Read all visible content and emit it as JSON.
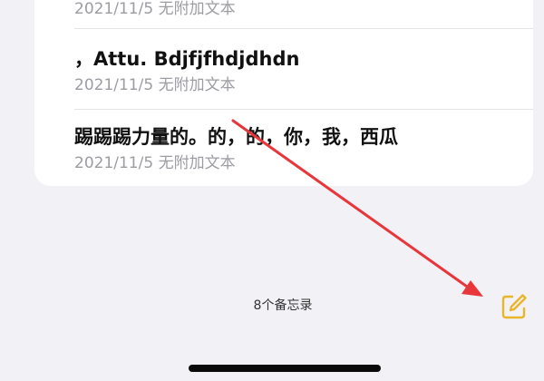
{
  "notes": [
    {
      "title": "",
      "meta": "2021/11/5  无附加文本"
    },
    {
      "title": "，Attu.  Bdjfjfhdjdhdn",
      "meta": "2021/11/5  无附加文本"
    },
    {
      "title": "踢踢踢力量的。的，的，你，我，西瓜",
      "meta": "2021/11/5  无附加文本"
    }
  ],
  "footer": {
    "count_label": "8个备忘录"
  },
  "icons": {
    "compose": "compose-note-icon"
  },
  "colors": {
    "accent": "#e9b52b",
    "annotation_arrow": "#e8373a",
    "background": "#f1f1f6",
    "card": "#ffffff"
  }
}
